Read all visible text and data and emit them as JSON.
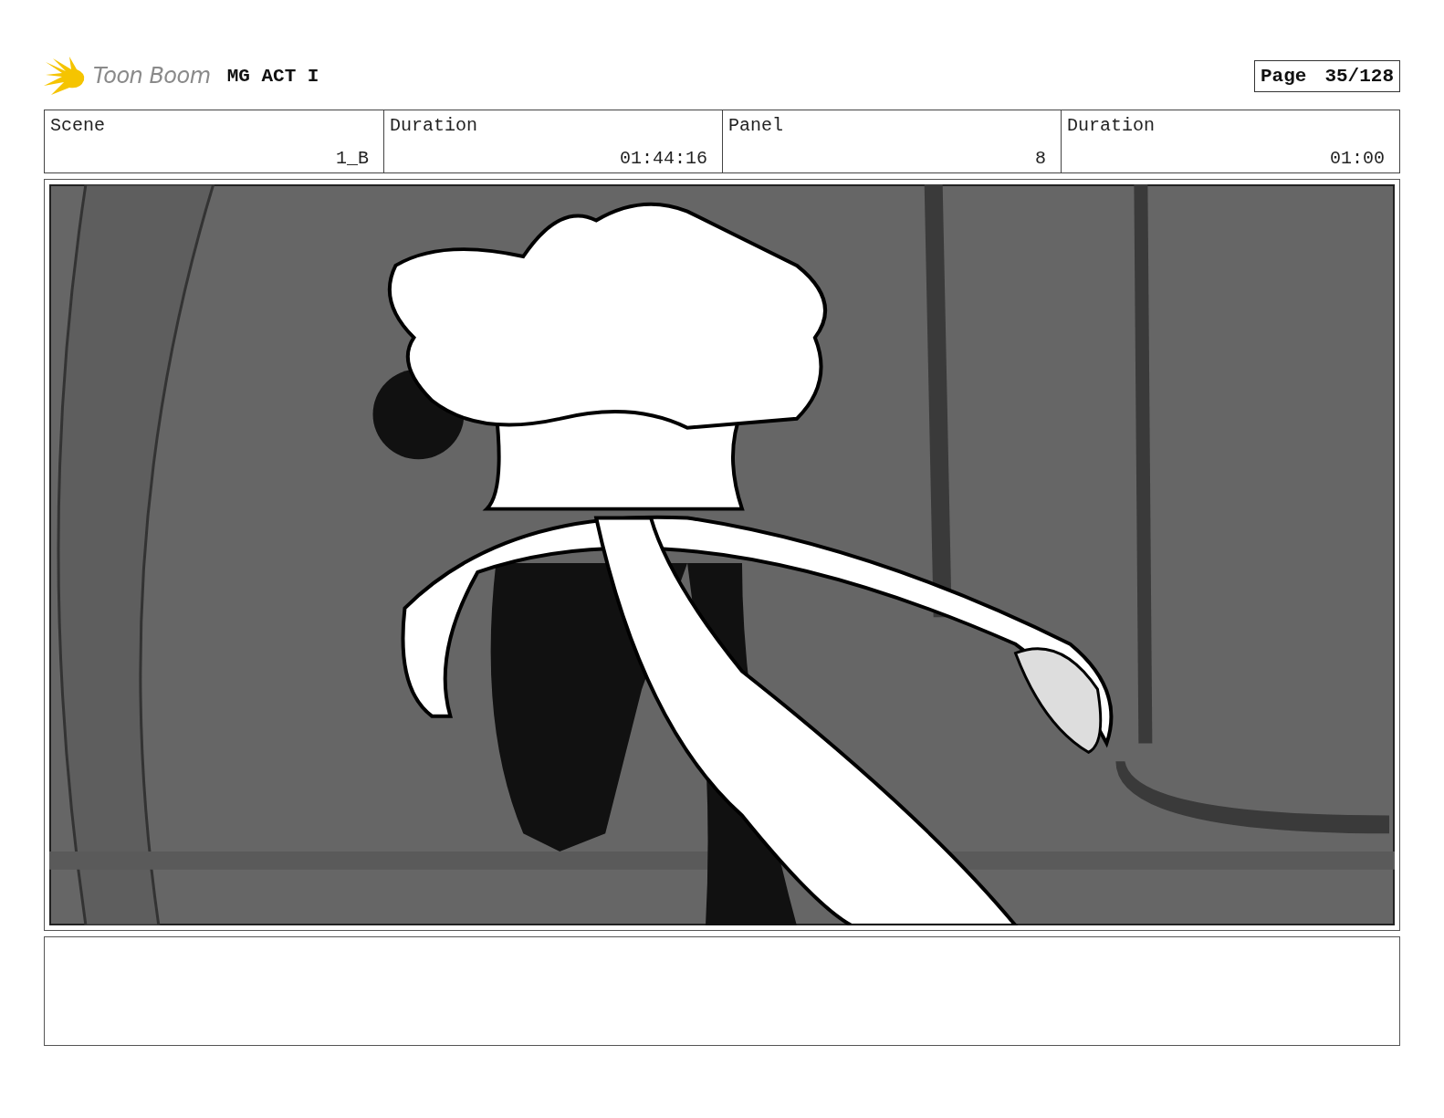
{
  "header": {
    "logo_text": "Toon Boom",
    "title": "MG ACT I",
    "page": {
      "label": "Page",
      "value": "35/128"
    }
  },
  "info": [
    {
      "label": "Scene",
      "value": "1_B"
    },
    {
      "label": "Duration",
      "value": "01:44:16"
    },
    {
      "label": "Panel",
      "value": "8"
    },
    {
      "label": "Duration",
      "value": "01:00"
    }
  ]
}
